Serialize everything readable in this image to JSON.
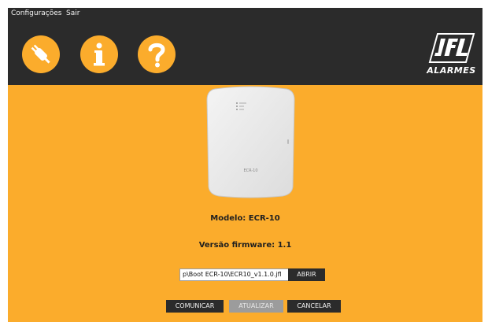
{
  "menubar": {
    "items": [
      {
        "label": "Configurações"
      },
      {
        "label": "Sair"
      }
    ]
  },
  "toolbar": {
    "icons": [
      "connection-icon",
      "info-icon",
      "help-icon"
    ],
    "logo_text": "ALARMES"
  },
  "device": {
    "model_label": "ECR-10"
  },
  "info": {
    "model": "Modelo: ECR-10",
    "firmware": "Versão firmware: 1.1"
  },
  "file": {
    "path": "p\\Boot ECR-10\\ECR10_v1.1.0.jfl",
    "open_label": "ABRIR"
  },
  "actions": {
    "communicate_label": "COMUNICAR",
    "update_label": "ATUALIZAR",
    "cancel_label": "CANCELAR"
  },
  "colors": {
    "accent": "#fbac2c",
    "dark": "#2b2b2b",
    "disabled": "#9c9c9c"
  }
}
